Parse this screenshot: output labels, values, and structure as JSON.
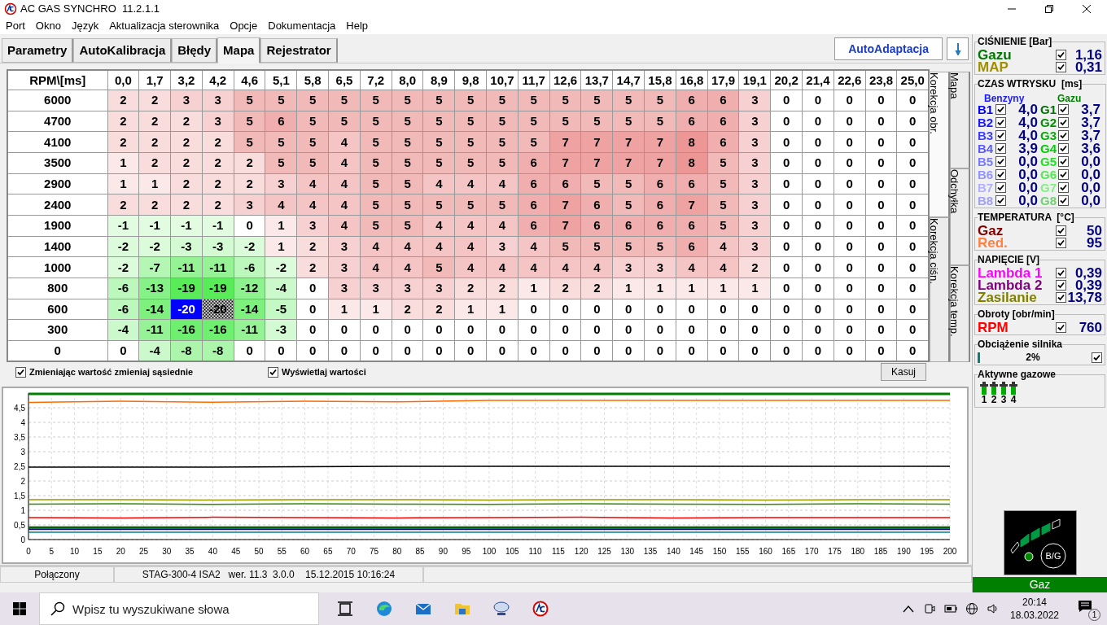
{
  "window": {
    "title": "AC GAS SYNCHRO  11.2.1.1"
  },
  "menu": [
    "Port",
    "Okno",
    "Język",
    "Aktualizacja sterownika",
    "Opcje",
    "Dokumentacja",
    "Help"
  ],
  "tabs": [
    {
      "label": "Parametry",
      "selected": false
    },
    {
      "label": "AutoKalibracja",
      "selected": false
    },
    {
      "label": "Błędy",
      "selected": false
    },
    {
      "label": "Mapa",
      "selected": true
    },
    {
      "label": "Rejestrator",
      "selected": false
    }
  ],
  "auto_button": "AutoAdaptacja",
  "map": {
    "corner": "RPM\\[ms]",
    "columns": [
      "0,0",
      "1,7",
      "3,2",
      "4,2",
      "4,6",
      "5,1",
      "5,8",
      "6,5",
      "7,2",
      "8,0",
      "8,9",
      "9,8",
      "10,7",
      "11,7",
      "12,6",
      "13,7",
      "14,7",
      "15,8",
      "16,8",
      "17,9",
      "19,1",
      "20,2",
      "21,4",
      "22,6",
      "23,8",
      "25,0"
    ],
    "rows": [
      {
        "rpm": "6000",
        "cells": [
          "2",
          "2",
          "3",
          "3",
          "5",
          "5",
          "5",
          "5",
          "5",
          "5",
          "5",
          "5",
          "5",
          "5",
          "5",
          "5",
          "5",
          "5",
          "6",
          "6",
          "3",
          "0",
          "0",
          "0",
          "0",
          "0"
        ]
      },
      {
        "rpm": "4700",
        "cells": [
          "2",
          "2",
          "2",
          "3",
          "5",
          "6",
          "5",
          "5",
          "5",
          "5",
          "5",
          "5",
          "5",
          "5",
          "5",
          "5",
          "5",
          "5",
          "6",
          "6",
          "3",
          "0",
          "0",
          "0",
          "0",
          "0"
        ]
      },
      {
        "rpm": "4100",
        "cells": [
          "2",
          "2",
          "2",
          "2",
          "5",
          "5",
          "5",
          "4",
          "5",
          "5",
          "5",
          "5",
          "5",
          "5",
          "7",
          "7",
          "7",
          "7",
          "8",
          "6",
          "3",
          "0",
          "0",
          "0",
          "0",
          "0"
        ]
      },
      {
        "rpm": "3500",
        "cells": [
          "1",
          "2",
          "2",
          "2",
          "2",
          "5",
          "5",
          "4",
          "5",
          "5",
          "5",
          "5",
          "5",
          "6",
          "7",
          "7",
          "7",
          "7",
          "8",
          "5",
          "3",
          "0",
          "0",
          "0",
          "0",
          "0"
        ]
      },
      {
        "rpm": "2900",
        "cells": [
          "1",
          "1",
          "2",
          "2",
          "2",
          "3",
          "4",
          "4",
          "5",
          "5",
          "4",
          "4",
          "4",
          "6",
          "6",
          "5",
          "5",
          "6",
          "6",
          "5",
          "3",
          "0",
          "0",
          "0",
          "0",
          "0"
        ]
      },
      {
        "rpm": "2400",
        "cells": [
          "2",
          "2",
          "2",
          "2",
          "3",
          "4",
          "4",
          "4",
          "5",
          "5",
          "5",
          "5",
          "5",
          "6",
          "7",
          "6",
          "5",
          "6",
          "7",
          "5",
          "3",
          "0",
          "0",
          "0",
          "0",
          "0"
        ]
      },
      {
        "rpm": "1900",
        "cells": [
          "-1",
          "-1",
          "-1",
          "-1",
          "0",
          "1",
          "3",
          "4",
          "5",
          "5",
          "4",
          "4",
          "4",
          "6",
          "7",
          "6",
          "6",
          "6",
          "6",
          "5",
          "3",
          "0",
          "0",
          "0",
          "0",
          "0"
        ]
      },
      {
        "rpm": "1400",
        "cells": [
          "-2",
          "-2",
          "-3",
          "-3",
          "-2",
          "1",
          "2",
          "3",
          "4",
          "4",
          "4",
          "4",
          "3",
          "4",
          "5",
          "5",
          "5",
          "5",
          "6",
          "4",
          "3",
          "0",
          "0",
          "0",
          "0",
          "0"
        ]
      },
      {
        "rpm": "1000",
        "cells": [
          "-2",
          "-7",
          "-11",
          "-11",
          "-6",
          "-2",
          "2",
          "3",
          "4",
          "4",
          "5",
          "4",
          "4",
          "4",
          "4",
          "4",
          "3",
          "3",
          "4",
          "4",
          "2",
          "0",
          "0",
          "0",
          "0",
          "0"
        ]
      },
      {
        "rpm": "800",
        "cells": [
          "-6",
          "-13",
          "-19",
          "-19",
          "-12",
          "-4",
          "0",
          "3",
          "3",
          "3",
          "3",
          "2",
          "2",
          "1",
          "2",
          "2",
          "1",
          "1",
          "1",
          "1",
          "1",
          "0",
          "0",
          "0",
          "0",
          "0"
        ]
      },
      {
        "rpm": "600",
        "cells": [
          "-6",
          "-14",
          {
            "value": "-20",
            "selected": true
          },
          {
            "value": "-20",
            "marked": true
          },
          "-14",
          "-5",
          "0",
          "1",
          "1",
          "2",
          "2",
          "1",
          "1",
          "0",
          "0",
          "0",
          "0",
          "0",
          "0",
          "0",
          "0",
          "0",
          "0",
          "0",
          "0",
          "0"
        ]
      },
      {
        "rpm": "300",
        "cells": [
          "-4",
          "-11",
          "-16",
          "-16",
          "-11",
          "-3",
          "0",
          "0",
          "0",
          "0",
          "0",
          "0",
          "0",
          "0",
          "0",
          "0",
          "0",
          "0",
          "0",
          "0",
          "0",
          "0",
          "0",
          "0",
          "0",
          "0"
        ]
      },
      {
        "rpm": "0",
        "cells": [
          "0",
          "-4",
          "-8",
          "-8",
          "0",
          "0",
          "0",
          "0",
          "0",
          "0",
          "0",
          "0",
          "0",
          "0",
          "0",
          "0",
          "0",
          "0",
          "0",
          "0",
          "0",
          "0",
          "0",
          "0",
          "0",
          "0"
        ]
      }
    ]
  },
  "side_tabs": [
    [
      {
        "label": "Korekcja obr.",
        "selected": true
      },
      {
        "label": "Korekcja ciśn.",
        "selected": false
      }
    ],
    [
      {
        "label": "Mapa",
        "selected": false
      },
      {
        "label": "Odchyłka",
        "selected": false
      },
      {
        "label": "Korekcja temp.",
        "selected": false
      }
    ]
  ],
  "options": [
    {
      "label": "Zmieniając wartość zmieniaj sąsiednie",
      "checked": true
    },
    {
      "label": "Wyświetlaj wartości",
      "checked": true
    }
  ],
  "clear_button": "Kasuj",
  "chart_data": {
    "type": "line",
    "grid": true,
    "x": [
      0,
      20,
      40,
      60,
      80,
      100,
      120,
      140,
      160,
      180,
      200
    ],
    "xlim": [
      0,
      200
    ],
    "ylim": [
      0,
      5
    ],
    "xticks": [
      0,
      5,
      10,
      15,
      20,
      25,
      30,
      35,
      40,
      45,
      50,
      55,
      60,
      65,
      70,
      75,
      80,
      85,
      90,
      95,
      100,
      105,
      110,
      115,
      120,
      125,
      130,
      135,
      140,
      145,
      150,
      155,
      160,
      165,
      170,
      175,
      180,
      185,
      190,
      195,
      200
    ],
    "yticks": [
      {
        "value": 0,
        "label": "0"
      },
      {
        "value": 0.5,
        "label": "0,5"
      },
      {
        "value": 1,
        "label": "1"
      },
      {
        "value": 1.5,
        "label": "1,5"
      },
      {
        "value": 2,
        "label": "2"
      },
      {
        "value": 2.5,
        "label": "2,5"
      },
      {
        "value": 3,
        "label": "3"
      },
      {
        "value": 3.5,
        "label": "3,5"
      },
      {
        "value": 4,
        "label": "4"
      },
      {
        "value": 4.5,
        "label": "4,5"
      }
    ],
    "series": [
      {
        "color": "#008000",
        "values": [
          4.97,
          4.97,
          4.97,
          4.97,
          4.97,
          4.97,
          4.97,
          4.97,
          4.97,
          4.97,
          4.97
        ]
      },
      {
        "color": "#ff6a00",
        "values": [
          4.68,
          4.72,
          4.69,
          4.72,
          4.7,
          4.75,
          4.75,
          4.75,
          4.75,
          4.75,
          4.75
        ]
      },
      {
        "color": "#000000",
        "values": [
          2.47,
          2.47,
          2.47,
          2.49,
          2.5,
          2.5,
          2.5,
          2.5,
          2.5,
          2.5,
          2.5
        ]
      },
      {
        "color": "#999900",
        "values": [
          1.36,
          1.36,
          1.35,
          1.36,
          1.36,
          1.35,
          1.36,
          1.36,
          1.35,
          1.36,
          1.36
        ]
      },
      {
        "color": "#2e8b00",
        "values": [
          1.21,
          1.22,
          1.2,
          1.22,
          1.21,
          1.2,
          1.22,
          1.21,
          1.2,
          1.22,
          1.21
        ]
      },
      {
        "color": "#ff0000",
        "values": [
          0.75,
          0.74,
          0.76,
          0.75,
          0.74,
          0.75,
          0.76,
          0.74,
          0.75,
          0.75,
          0.75
        ]
      },
      {
        "color": "#006400",
        "values": [
          0.41,
          0.41,
          0.41,
          0.41,
          0.41,
          0.41,
          0.41,
          0.41,
          0.41,
          0.41,
          0.41
        ]
      },
      {
        "color": "#000080",
        "values": [
          0.35,
          0.35,
          0.35,
          0.35,
          0.35,
          0.35,
          0.35,
          0.35,
          0.35,
          0.35,
          0.35
        ]
      },
      {
        "color": "#008080",
        "values": [
          0.25,
          0.25,
          0.25,
          0.25,
          0.25,
          0.25,
          0.25,
          0.25,
          0.25,
          0.25,
          0.25
        ]
      }
    ]
  },
  "status_bar": [
    "Połączony",
    "STAG-300-4 ISA2   wer. 11.3  3.0.0    15.12.2015 10:16:24"
  ],
  "panel": {
    "pressure": {
      "title": "CIŚNIENIE [Bar]",
      "rows": [
        {
          "label": "Gazu",
          "color": "#007700",
          "checked": true,
          "value": "1,16"
        },
        {
          "label": "MAP",
          "color": "#a09000",
          "checked": true,
          "value": "0,31"
        }
      ]
    },
    "injection": {
      "title": "CZAS WTRYSKU  [ms]",
      "petrol_header": "Benzyny",
      "gas_header": "Gazu",
      "rows": [
        {
          "petrol": {
            "label": "B1",
            "color": "#0000ff",
            "checked": true,
            "value": "4,0"
          },
          "gas": {
            "label": "G1",
            "color": "#007000",
            "checked": true,
            "value": "3,7"
          }
        },
        {
          "petrol": {
            "label": "B2",
            "color": "#1a1aff",
            "checked": true,
            "value": "4,0"
          },
          "gas": {
            "label": "G2",
            "color": "#009000",
            "checked": true,
            "value": "3,7"
          }
        },
        {
          "petrol": {
            "label": "B3",
            "color": "#3c3cff",
            "checked": true,
            "value": "4,0"
          },
          "gas": {
            "label": "G3",
            "color": "#00b000",
            "checked": true,
            "value": "3,7"
          }
        },
        {
          "petrol": {
            "label": "B4",
            "color": "#5a5aff",
            "checked": true,
            "value": "3,9"
          },
          "gas": {
            "label": "G4",
            "color": "#00d000",
            "checked": true,
            "value": "3,6"
          }
        },
        {
          "petrol": {
            "label": "B5",
            "color": "#7a7aff",
            "checked": true,
            "value": "0,0"
          },
          "gas": {
            "label": "G5",
            "color": "#20e020",
            "checked": true,
            "value": "0,0"
          }
        },
        {
          "petrol": {
            "label": "B6",
            "color": "#9494ff",
            "checked": true,
            "value": "0,0"
          },
          "gas": {
            "label": "G6",
            "color": "#50e850",
            "checked": true,
            "value": "0,0"
          }
        },
        {
          "petrol": {
            "label": "B7",
            "color": "#b0b0ff",
            "checked": true,
            "value": "0,0"
          },
          "gas": {
            "label": "G7",
            "color": "#80f080",
            "checked": true,
            "value": "0,0"
          }
        },
        {
          "petrol": {
            "label": "B8",
            "color": "#a0a0f4",
            "checked": true,
            "value": "0,0"
          },
          "gas": {
            "label": "G8",
            "color": "#70d070",
            "checked": true,
            "value": "0,0"
          }
        }
      ]
    },
    "temperature": {
      "title": "TEMPERATURA  [°C]",
      "rows": [
        {
          "label": "Gaz",
          "color": "#800000",
          "checked": true,
          "value": "50"
        },
        {
          "label": "Red.",
          "color": "#ff8040",
          "checked": true,
          "value": "95"
        }
      ]
    },
    "voltage": {
      "title": "NAPIĘCIE [V]",
      "rows": [
        {
          "label": "Lambda 1",
          "color": "#ff00ff",
          "checked": true,
          "value": "0,39"
        },
        {
          "label": "Lambda 2",
          "color": "#800080",
          "checked": true,
          "value": "0,39"
        },
        {
          "label": "Zasilanie",
          "color": "#808000",
          "checked": true,
          "value": "13,78"
        }
      ]
    },
    "speed": {
      "title": "Obroty [obr/min]",
      "rows": [
        {
          "label": "RPM",
          "color": "#ff0000",
          "checked": true,
          "value": "760"
        }
      ]
    },
    "load": {
      "title": "Obciążenie silnika",
      "level": 0.02,
      "reading": "2%",
      "checked": true
    },
    "injectors": {
      "title": "Aktywne gazowe",
      "items": [
        {
          "label": "1",
          "active": true
        },
        {
          "label": "2",
          "active": true
        },
        {
          "label": "3",
          "active": true
        },
        {
          "label": "4",
          "active": true
        }
      ]
    },
    "gauge": {
      "label": "B/G",
      "gas_mode": true
    },
    "mode": "Gaz"
  },
  "taskbar": {
    "search_placeholder": "Wpisz tu wyszukiwane słowa",
    "time": "20:14",
    "date": "18.03.2022",
    "notifications": "1"
  }
}
